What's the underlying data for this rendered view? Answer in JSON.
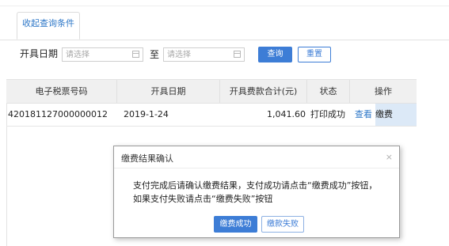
{
  "tab": {
    "label": "收起查询条件"
  },
  "filter": {
    "date_label": "开具日期",
    "start_placeholder": "请选择",
    "to_label": "至",
    "end_placeholder": "请选择",
    "query_button": "查询",
    "reset_button": "重置"
  },
  "table": {
    "headers": [
      "电子税票号码",
      "开具日期",
      "开具费款合计(元)",
      "状态",
      "操作"
    ],
    "rows": [
      {
        "ticket_no": "420181127000000012",
        "date": "2019-1-24",
        "amount": "1,041.60",
        "status": "打印成功",
        "action_view": "查看",
        "action_pay": "缴费"
      }
    ]
  },
  "dialog": {
    "title": "缴费结果确认",
    "close": "×",
    "message_line1": "支付完成后请确认缴费结果，支付成功请点击“缴费成功”按钮，",
    "message_line2": "如果支付失败请点击“缴费失败”按钮",
    "success_button": "缴费成功",
    "fail_button": "缴款失败"
  },
  "colors": {
    "primary": "#3d7dd6",
    "link": "#2f78c8",
    "header_bg": "#f0f0f0",
    "selected_cell_bg": "#dce9f7"
  }
}
